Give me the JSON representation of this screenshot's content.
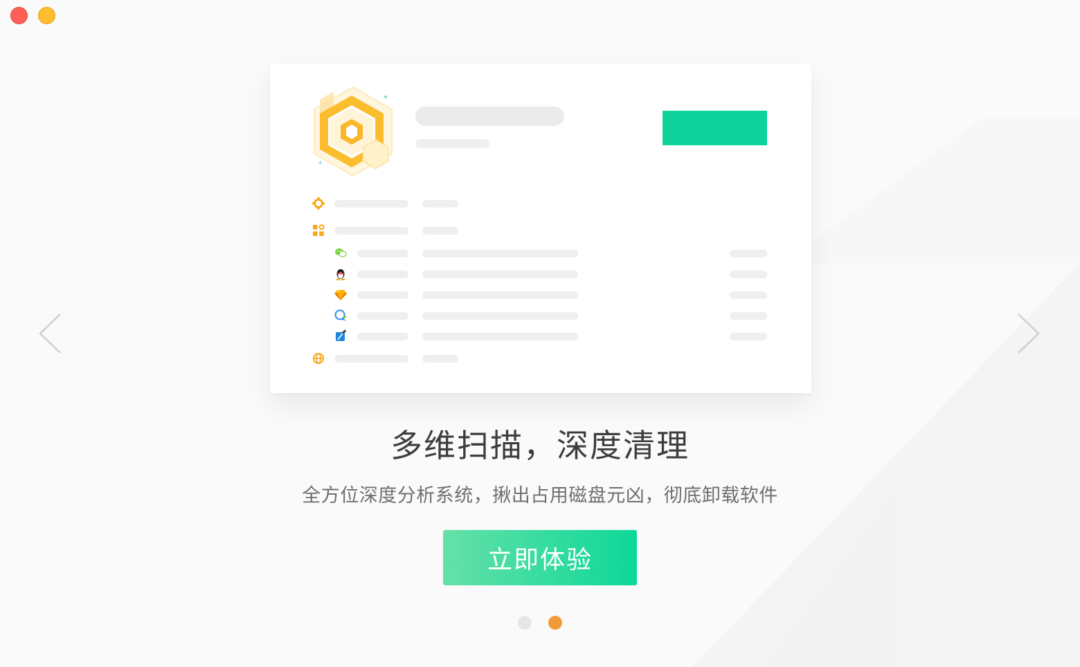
{
  "window": {
    "controls": [
      "close",
      "minimize"
    ]
  },
  "slide": {
    "headline": "多维扫描，深度清理",
    "subtitle": "全方位深度分析系统，揪出占用磁盘元凶，彻底卸载软件",
    "cta_label": "立即体验"
  },
  "preview": {
    "logo_icon": "hexagon-logo-icon",
    "row_icons": [
      "gear-icon",
      "apps-grid-icon",
      "wechat-icon",
      "qq-penguin-icon",
      "sketch-diamond-icon",
      "chat-bubble-icon",
      "xcode-hammer-icon",
      "globe-icon"
    ]
  },
  "pagination": {
    "count": 2,
    "active_index": 1
  },
  "colors": {
    "accent_green": "#0dd29a",
    "accent_orange": "#f29a38",
    "icon_orange": "#f7a71b"
  }
}
